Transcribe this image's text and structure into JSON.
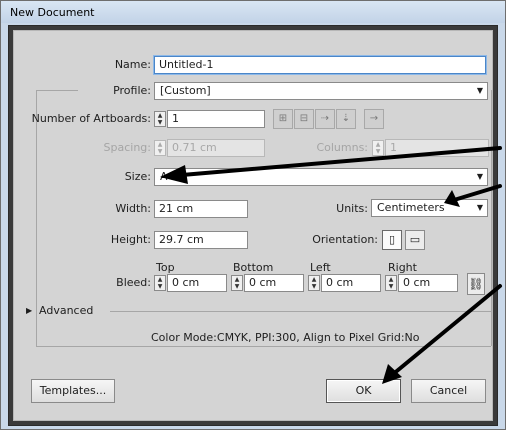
{
  "window": {
    "title": "New Document"
  },
  "name": {
    "label": "Name:",
    "value": "Untitled-1"
  },
  "profile": {
    "label": "Profile:",
    "value": "[Custom]"
  },
  "artboards": {
    "label": "Number of Artboards:",
    "value": "1"
  },
  "spacing": {
    "label": "Spacing:",
    "value": "0.71 cm"
  },
  "columns": {
    "label": "Columns:",
    "value": "1"
  },
  "size": {
    "label": "Size:",
    "value": "A4"
  },
  "width": {
    "label": "Width:",
    "value": "21 cm"
  },
  "units": {
    "label": "Units:",
    "value": "Centimeters"
  },
  "height": {
    "label": "Height:",
    "value": "29.7 cm"
  },
  "orientation": {
    "label": "Orientation:",
    "selected": "portrait"
  },
  "bleed": {
    "label": "Bleed:",
    "top": {
      "label": "Top",
      "value": "0 cm"
    },
    "bottom": {
      "label": "Bottom",
      "value": "0 cm"
    },
    "left": {
      "label": "Left",
      "value": "0 cm"
    },
    "right": {
      "label": "Right",
      "value": "0 cm"
    }
  },
  "advanced": {
    "label": "Advanced"
  },
  "summary": "Color Mode:CMYK, PPI:300, Align to Pixel Grid:No",
  "buttons": {
    "templates": "Templates...",
    "ok": "OK",
    "cancel": "Cancel"
  },
  "icons": {
    "spinner": "spinner-arrows-icon",
    "grid_by_row": "grid-by-row-icon",
    "grid_by_column": "grid-by-column-icon",
    "arrange_by_row": "arrange-by-row-icon",
    "arrange_by_column": "arrange-by-column-icon",
    "right_to_left": "right-to-left-icon",
    "portrait": "portrait-orientation-icon",
    "landscape": "landscape-orientation-icon",
    "link": "link-bleed-icon",
    "expand": "disclosure-triangle-icon",
    "dropdown": "dropdown-arrow-icon"
  },
  "colors": {
    "window_frame": "#c9d8e9",
    "panel": "#d4d4d4",
    "focus_border": "#4b86c8",
    "annotation_arrow": "#000000"
  }
}
